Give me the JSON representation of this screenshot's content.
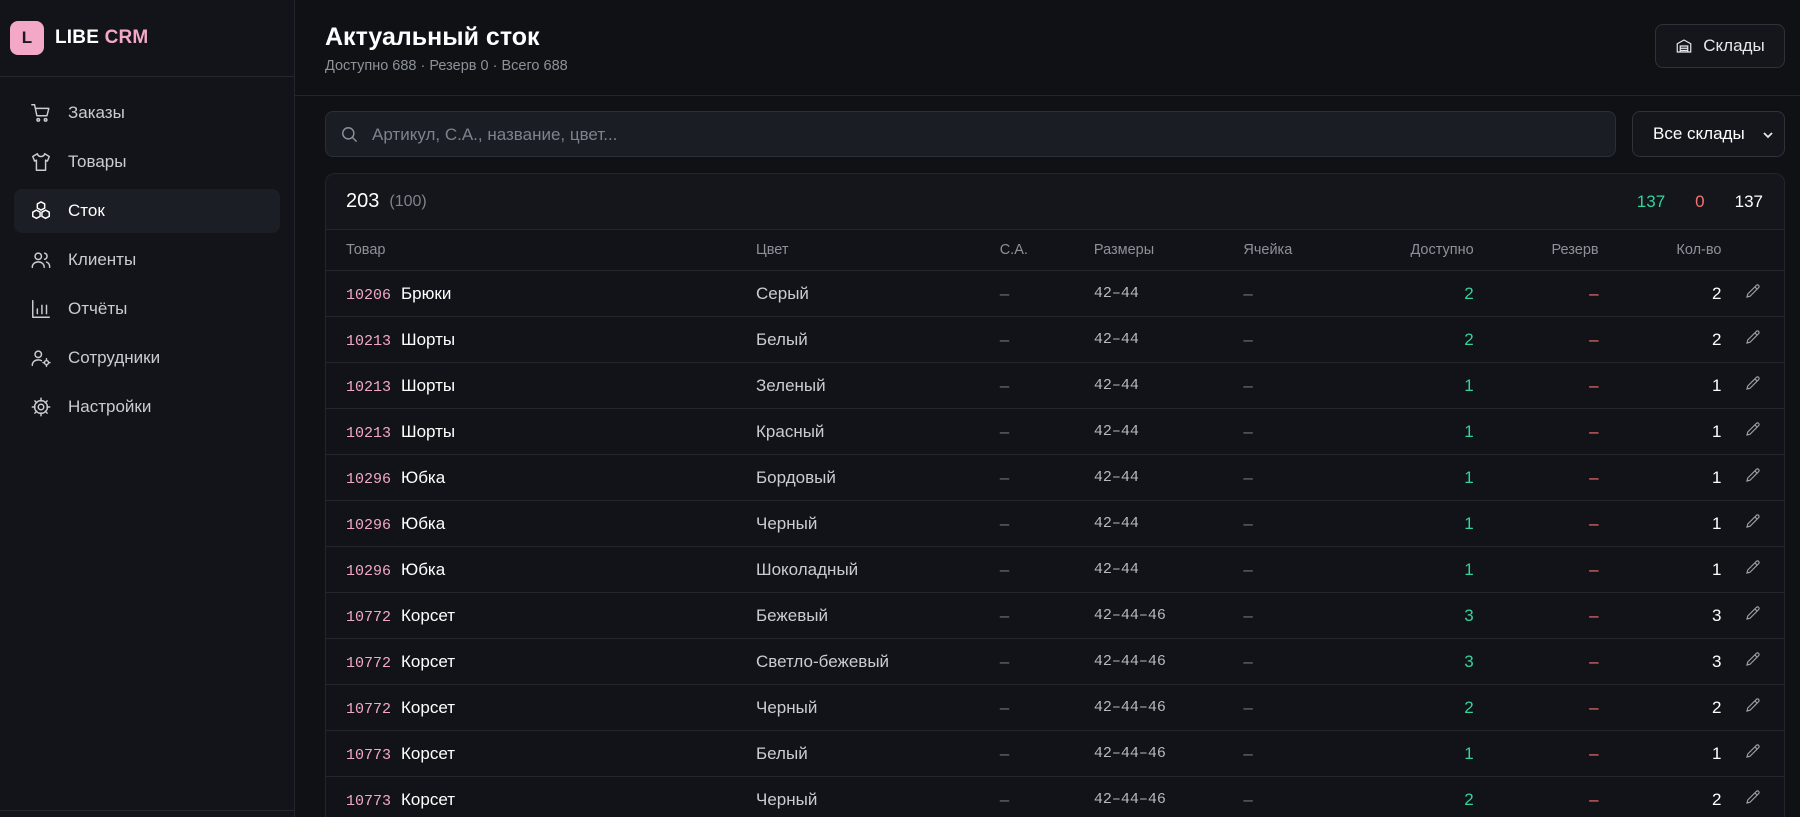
{
  "brand": {
    "logo_letter": "L",
    "name_part1": "LIBE",
    "name_part2": "CRM"
  },
  "sidebar": {
    "items": [
      {
        "label": "Заказы",
        "icon": "cart-icon",
        "active": false
      },
      {
        "label": "Товары",
        "icon": "shirt-icon",
        "active": false
      },
      {
        "label": "Сток",
        "icon": "boxes-icon",
        "active": true
      },
      {
        "label": "Клиенты",
        "icon": "users-icon",
        "active": false
      },
      {
        "label": "Отчёты",
        "icon": "bar-chart-icon",
        "active": false
      },
      {
        "label": "Сотрудники",
        "icon": "user-cog-icon",
        "active": false
      },
      {
        "label": "Настройки",
        "icon": "gear-icon",
        "active": false
      }
    ]
  },
  "header": {
    "title": "Актуальный сток",
    "subtitle": "Доступно 688 · Резерв 0 · Всего 688",
    "warehouses_button": "Склады"
  },
  "search": {
    "placeholder": "Артикул, С.А., название, цвет..."
  },
  "warehouse_select": {
    "value": "Все склады"
  },
  "summary": {
    "count": "203",
    "count_sub": "(100)",
    "total_available": "137",
    "total_reserve": "0",
    "total_qty": "137"
  },
  "table": {
    "headers": [
      "Товар",
      "Цвет",
      "С.А.",
      "Размеры",
      "Ячейка",
      "Доступно",
      "Резерв",
      "Кол-во"
    ],
    "rows": [
      {
        "sku": "10206",
        "name": "Брюки",
        "color": "Серый",
        "sa": "–",
        "sizes": "42–44",
        "cell": "–",
        "available": "2",
        "reserve": "–",
        "qty": "2"
      },
      {
        "sku": "10213",
        "name": "Шорты",
        "color": "Белый",
        "sa": "–",
        "sizes": "42–44",
        "cell": "–",
        "available": "2",
        "reserve": "–",
        "qty": "2"
      },
      {
        "sku": "10213",
        "name": "Шорты",
        "color": "Зеленый",
        "sa": "–",
        "sizes": "42–44",
        "cell": "–",
        "available": "1",
        "reserve": "–",
        "qty": "1"
      },
      {
        "sku": "10213",
        "name": "Шорты",
        "color": "Красный",
        "sa": "–",
        "sizes": "42–44",
        "cell": "–",
        "available": "1",
        "reserve": "–",
        "qty": "1"
      },
      {
        "sku": "10296",
        "name": "Юбка",
        "color": "Бордовый",
        "sa": "–",
        "sizes": "42–44",
        "cell": "–",
        "available": "1",
        "reserve": "–",
        "qty": "1"
      },
      {
        "sku": "10296",
        "name": "Юбка",
        "color": "Черный",
        "sa": "–",
        "sizes": "42–44",
        "cell": "–",
        "available": "1",
        "reserve": "–",
        "qty": "1"
      },
      {
        "sku": "10296",
        "name": "Юбка",
        "color": "Шоколадный",
        "sa": "–",
        "sizes": "42–44",
        "cell": "–",
        "available": "1",
        "reserve": "–",
        "qty": "1"
      },
      {
        "sku": "10772",
        "name": "Корсет",
        "color": "Бежевый",
        "sa": "–",
        "sizes": "42–44–46",
        "cell": "–",
        "available": "3",
        "reserve": "–",
        "qty": "3"
      },
      {
        "sku": "10772",
        "name": "Корсет",
        "color": "Светло-бежевый",
        "sa": "–",
        "sizes": "42–44–46",
        "cell": "–",
        "available": "3",
        "reserve": "–",
        "qty": "3"
      },
      {
        "sku": "10772",
        "name": "Корсет",
        "color": "Черный",
        "sa": "–",
        "sizes": "42–44–46",
        "cell": "–",
        "available": "2",
        "reserve": "–",
        "qty": "2"
      },
      {
        "sku": "10773",
        "name": "Корсет",
        "color": "Белый",
        "sa": "–",
        "sizes": "42–44–46",
        "cell": "–",
        "available": "1",
        "reserve": "–",
        "qty": "1"
      },
      {
        "sku": "10773",
        "name": "Корсет",
        "color": "Черный",
        "sa": "–",
        "sizes": "42–44–46",
        "cell": "–",
        "available": "2",
        "reserve": "–",
        "qty": "2"
      }
    ]
  },
  "colors": {
    "accent": "#f3a8c7",
    "available": "#34d399",
    "reserve": "#f87171",
    "background": "#0f1115"
  }
}
